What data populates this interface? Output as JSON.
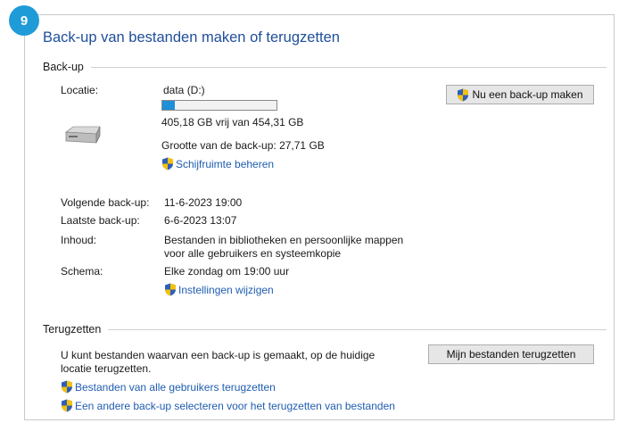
{
  "step_badge": "9",
  "title": "Back-up van bestanden maken of terugzetten",
  "backup": {
    "section_label": "Back-up",
    "location_label": "Locatie:",
    "location_value": "data (D:)",
    "disk_used_fraction": 0.11,
    "free_space": "405,18 GB vrij van 454,31 GB",
    "backup_size": "Grootte van de back-up: 27,71 GB",
    "manage_space_link": "Schijfruimte beheren",
    "backup_now_button": "Nu een back-up maken",
    "next_backup_label": "Volgende back-up:",
    "next_backup_value": "11-6-2023 19:00",
    "last_backup_label": "Laatste back-up:",
    "last_backup_value": "6-6-2023 13:07",
    "contents_label": "Inhoud:",
    "contents_value_line1": "Bestanden in bibliotheken en persoonlijke mappen",
    "contents_value_line2": "voor alle gebruikers en systeemkopie",
    "schedule_label": "Schema:",
    "schedule_value": "Elke zondag om 19:00 uur",
    "change_settings_link": "Instellingen wijzigen"
  },
  "restore": {
    "section_label": "Terugzetten",
    "description_line1": "U kunt bestanden waarvan een back-up is gemaakt, op de huidige",
    "description_line2": "locatie terugzetten.",
    "restore_button": "Mijn bestanden terugzetten",
    "all_users_link": "Bestanden van alle gebruikers terugzetten",
    "other_backup_link": "Een andere back-up selecteren voor het terugzetten van bestanden"
  },
  "colors": {
    "title": "#1f4e9c",
    "link": "#1f5db0",
    "badge": "#1f9bd7",
    "progress": "#1e8fd8"
  }
}
